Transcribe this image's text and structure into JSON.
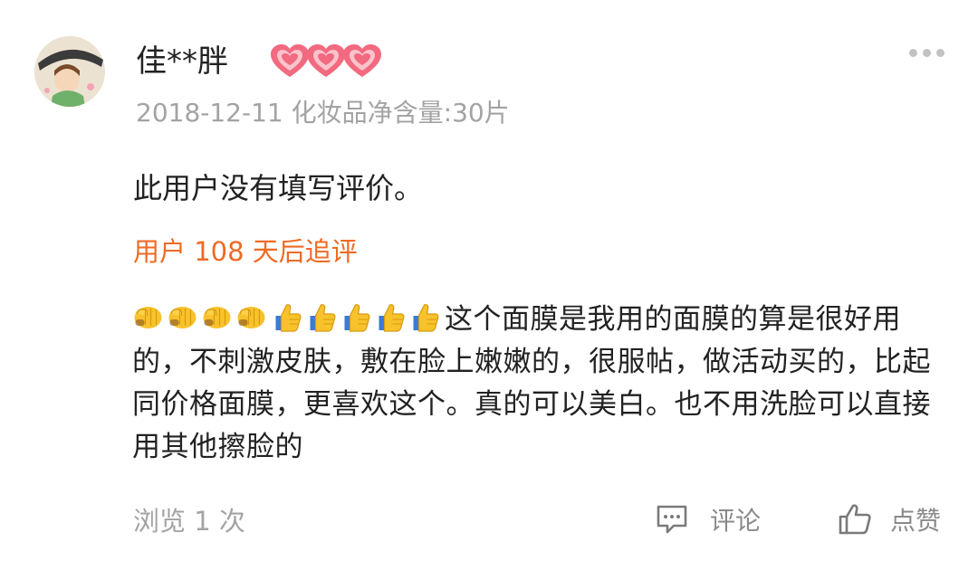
{
  "review": {
    "username": "佳**胖",
    "level_icon": "heart-badge-icon",
    "level_color": "#f0607a",
    "date": "2018-12-11",
    "spec": "化妆品净含量:30片",
    "content": "此用户没有填写评价。",
    "followup": {
      "title": "用户 108 天后追评",
      "emojis": [
        "fist-emoji",
        "fist-emoji",
        "fist-emoji",
        "fist-emoji",
        "thumbs-up-emoji",
        "thumbs-up-emoji",
        "thumbs-up-emoji",
        "thumbs-up-emoji",
        "thumbs-up-emoji"
      ],
      "text": "这个面膜是我用的面膜的算是很好用的，不刺激皮肤，敷在脸上嫩嫩的，很服帖，做活动买的，比起同价格面膜，更喜欢这个。真的可以美白。也不用洗脸可以直接用其他擦脸的"
    },
    "views": "浏览 1 次",
    "comment_label": "评论",
    "like_label": "点赞",
    "accent_color": "#ef6a24"
  }
}
